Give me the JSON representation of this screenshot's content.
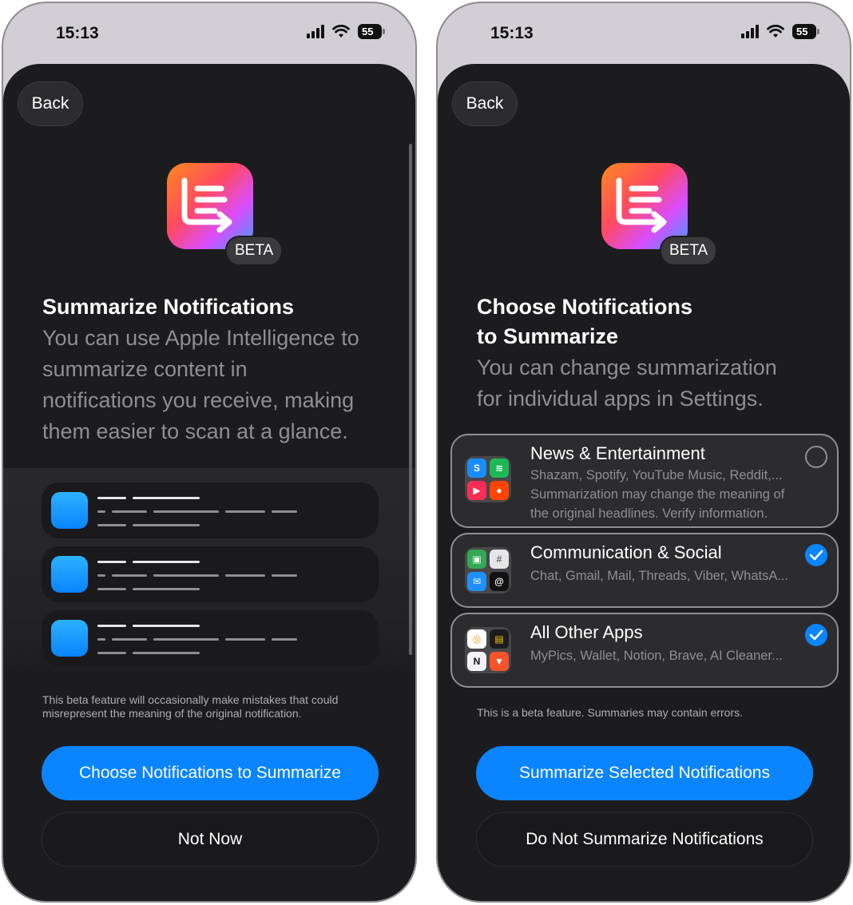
{
  "status_bar": {
    "time": "15:13",
    "battery": "55"
  },
  "left": {
    "back_label": "Back",
    "badge": "BETA",
    "title": "Summarize Notifications",
    "subtitle_lines": [
      "You can use Apple Intelligence to",
      "summarize content in",
      "notifications you receive, making",
      "them easier to scan at a glance."
    ],
    "disclaimer_lines": [
      "This beta feature will occasionally make mistakes that could",
      "misrepresent the meaning of the original notification."
    ],
    "primary_label": "Choose Notifications to Summarize",
    "secondary_label": "Not Now"
  },
  "right": {
    "back_label": "Back",
    "badge": "BETA",
    "title_lines": [
      "Choose Notifications",
      "to Summarize"
    ],
    "subtitle_lines": [
      "You can change summarization",
      "for individual apps in Settings."
    ],
    "options": [
      {
        "title": "News & Entertainment",
        "apps": "Shazam, Spotify, YouTube Music, Reddit,...",
        "note_lines": [
          "Summarization may change the meaning of",
          "the original headlines. Verify information."
        ],
        "selected": false
      },
      {
        "title": "Communication & Social",
        "apps": "Chat, Gmail, Mail, Threads, Viber, WhatsA...",
        "selected": true
      },
      {
        "title": "All Other Apps",
        "apps": "MyPics, Wallet, Notion, Brave, AI Cleaner...",
        "selected": true
      }
    ],
    "disclaimer": "This is a beta feature. Summaries may contain errors.",
    "primary_label": "Summarize Selected Notifications",
    "secondary_label": "Do Not Summarize Notifications"
  },
  "colors": {
    "accent": "#0a84ff",
    "sheet": "#1c1c1e",
    "card": "#2c2c2e"
  },
  "icons": [
    "summarize-app-icon",
    "checkmark-icon",
    "signal-icon",
    "wifi-icon",
    "battery-icon"
  ]
}
